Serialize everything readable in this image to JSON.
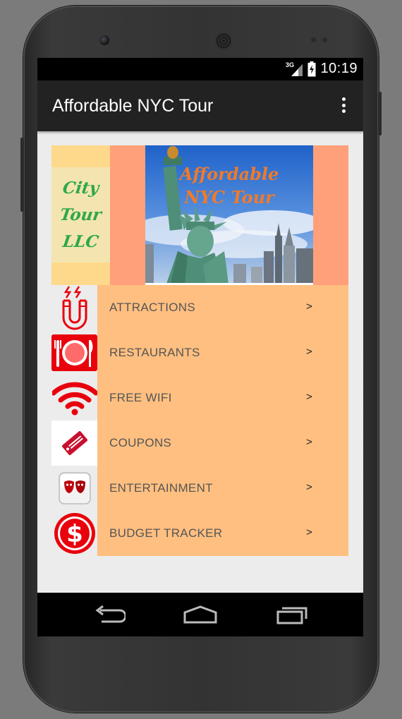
{
  "status_bar": {
    "network": "3G",
    "time": "10:19"
  },
  "app_bar": {
    "title": "Affordable NYC Tour",
    "overflow_icon": "more-vert-icon"
  },
  "banner": {
    "logo_lines": [
      "City",
      "Tour",
      "LLC"
    ],
    "photo_title_lines": [
      "Affordable",
      "NYC Tour"
    ],
    "colors": {
      "logo_bg": "#ffd98b",
      "banner_bg": "#ffa07a",
      "logo_text": "#2ea84a",
      "photo_title": "#f07a2a"
    }
  },
  "menu": {
    "arrow": ">",
    "items": [
      {
        "label": "ATTRACTIONS",
        "icon": "magnet-icon"
      },
      {
        "label": "RESTAURANTS",
        "icon": "plate-cutlery-icon"
      },
      {
        "label": "FREE WIFI",
        "icon": "wifi-icon"
      },
      {
        "label": "COUPONS",
        "icon": "discount-tag-icon"
      },
      {
        "label": "ENTERTAINMENT",
        "icon": "theater-masks-icon"
      },
      {
        "label": "BUDGET TRACKER",
        "icon": "dollar-icon"
      }
    ],
    "colors": {
      "row_bg": "#ffbf80",
      "icon_red": "#e8000c"
    }
  },
  "nav_bar": {
    "icons": [
      "back-icon",
      "home-icon",
      "recents-icon"
    ]
  }
}
